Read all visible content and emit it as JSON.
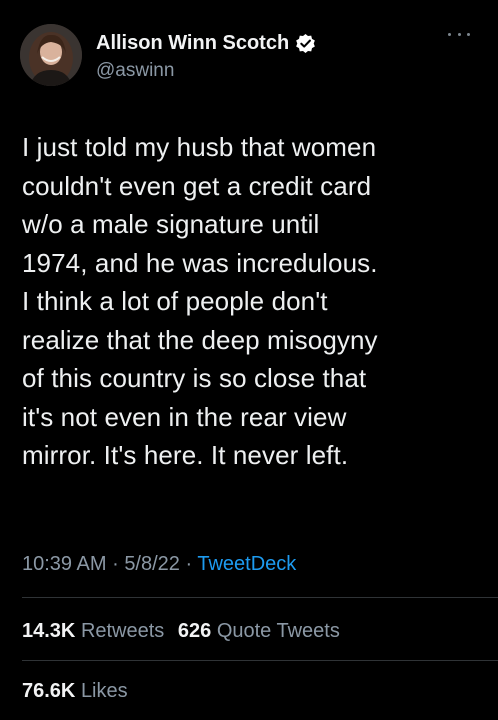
{
  "author": {
    "display_name": "Allison Winn Scotch",
    "handle": "@aswinn",
    "verified": true,
    "avatar_icon": "profile-photo"
  },
  "more_icon": "ellipsis-icon",
  "tweet": {
    "text": "I just told my husb that women\ncouldn't even get a credit card\nw/o a male signature until\n1974, and he was incredulous.\nI think a lot of people don't\nrealize that the deep misogyny\nof this country is so close that\nit's not even in the rear view\nmirror. It's here. It never left.",
    "time": "10:39 AM",
    "separator": "·",
    "date": "5/8/22",
    "source": "TweetDeck"
  },
  "stats": {
    "retweets_count": "14.3K",
    "retweets_label": "Retweets",
    "quotes_count": "626",
    "quotes_label": "Quote Tweets",
    "likes_count": "76.6K",
    "likes_label": "Likes"
  },
  "colors": {
    "background": "#000000",
    "text": "#e7e9ea",
    "muted": "#8b98a5",
    "link": "#1d9bf0",
    "verified_badge": "#ffffff"
  }
}
